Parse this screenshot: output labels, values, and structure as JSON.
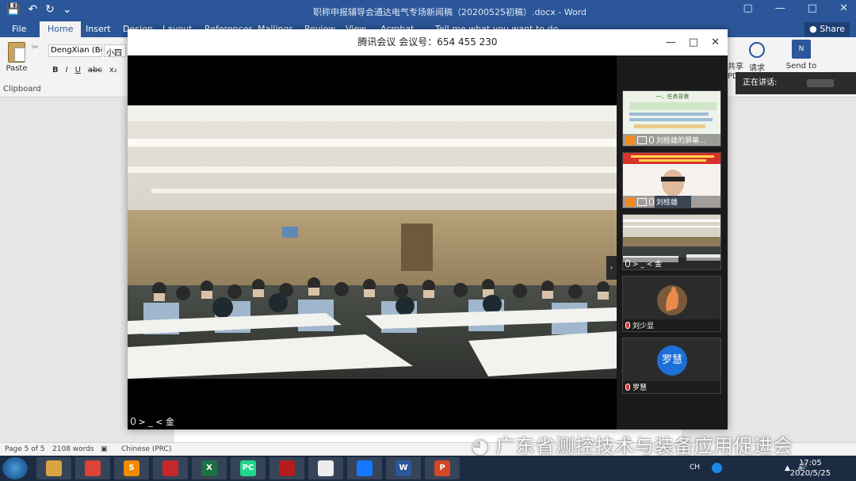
{
  "word": {
    "quick_access_glyphs": [
      "💾",
      "↶",
      "↻",
      "⌄"
    ],
    "doc_title": "职称申报辅导会通达电气专场新闻稿（20200525初稿）.docx - Word",
    "window_controls": [
      "▢",
      "—",
      "□",
      "✕"
    ],
    "tabs": {
      "file": "File",
      "home": "Home",
      "insert": "Insert",
      "design": "Design",
      "layout": "Layout",
      "references": "References",
      "mailings": "Mailings",
      "review": "Review",
      "view": "View",
      "acrobat": "Acrobat",
      "tell_me": "Tell me what you want to do"
    },
    "share_label": "Share",
    "ribbon": {
      "paste_label": "Paste",
      "clipboard_label": "Clipboard",
      "font_name": "DengXian (Bc",
      "font_size": "小四",
      "format_buttons": [
        "B",
        "I",
        "U",
        "abc",
        "x₂"
      ],
      "share_col_lines": [
        "共享",
        "PD"
      ],
      "request_label": "请求",
      "send_to_label": "Send to",
      "send_to_icon_text": "N"
    },
    "status": {
      "page": "Page 5 of 5",
      "words": "2108 words",
      "language": "Chinese (PRC)"
    }
  },
  "meeting": {
    "title": "腾讯会议  会议号：654 455 230",
    "window_controls": [
      "—",
      "□",
      "✕"
    ],
    "main_speaker": "> _ < 金",
    "collapse_glyph": "›",
    "participants": [
      {
        "name": "刘桂雄的屏幕..."
      },
      {
        "name": "刘桂雄"
      },
      {
        "name": "> _ < 金"
      },
      {
        "name": "刘少显"
      },
      {
        "name": "罗慧",
        "avatar_text": "罗慧"
      }
    ],
    "slide_title": "一、任务背景"
  },
  "speaking_label": "正在讲话:",
  "watermark": "广东省测控技术与装备应用促进会",
  "taskbar": {
    "apps": [
      {
        "name": "file-explorer",
        "color": "#d9a441",
        "text": ""
      },
      {
        "name": "chrome",
        "color": "#db4437",
        "text": ""
      },
      {
        "name": "sublime",
        "color": "#f28b00",
        "text": "S"
      },
      {
        "name": "app-red",
        "color": "#c62828",
        "text": ""
      },
      {
        "name": "excel",
        "color": "#1e7145",
        "text": "X"
      },
      {
        "name": "pycharm",
        "color": "#21d789",
        "text": "PC"
      },
      {
        "name": "cards",
        "color": "#b71c1c",
        "text": ""
      },
      {
        "name": "notepad",
        "color": "#ececec",
        "text": ""
      },
      {
        "name": "tencent-meeting",
        "color": "#1677ff",
        "text": ""
      },
      {
        "name": "word",
        "color": "#2b579a",
        "text": "W"
      },
      {
        "name": "powerpoint",
        "color": "#d24726",
        "text": "P"
      }
    ],
    "lang": "CH",
    "time": "17:05",
    "date": "2020/5/25"
  }
}
